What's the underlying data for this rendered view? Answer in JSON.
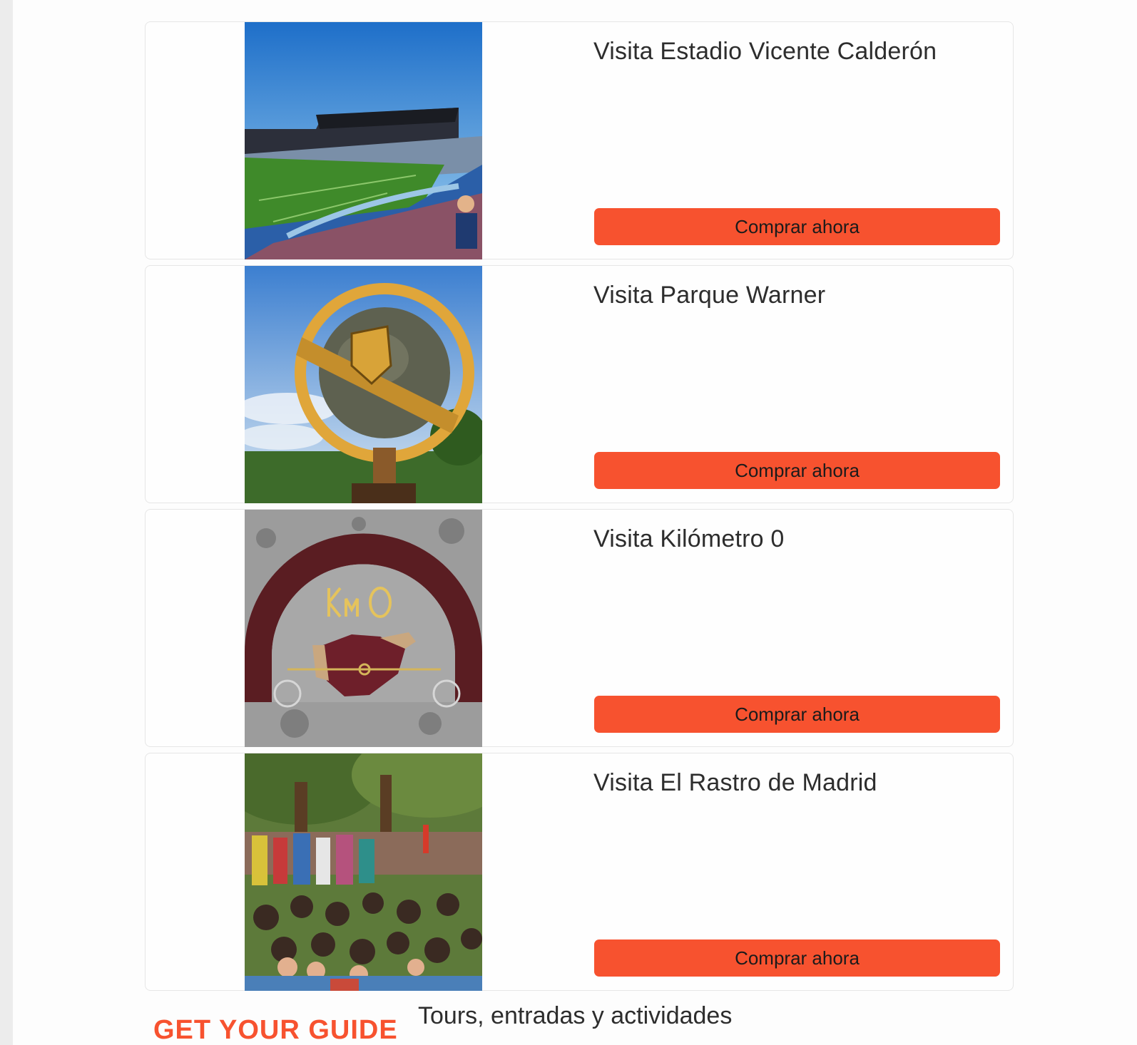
{
  "activities": [
    {
      "title": "Visita Estadio Vicente Calderón",
      "button": "Comprar ahora",
      "image": "stadium-photo"
    },
    {
      "title": "Visita Parque Warner",
      "button": "Comprar ahora",
      "image": "warner-globe-photo"
    },
    {
      "title": "Visita Kilómetro 0",
      "button": "Comprar ahora",
      "image": "km0-plaque-photo"
    },
    {
      "title": "Visita El Rastro de Madrid",
      "button": "Comprar ahora",
      "image": "rastro-market-photo"
    }
  ],
  "footer": {
    "logo_text": "GET YOUR GUIDE",
    "tagline": "Tours, entradas y actividades"
  },
  "colors": {
    "button": "#f7522f",
    "text": "#2d2d2d",
    "border": "#e6e6e6"
  }
}
